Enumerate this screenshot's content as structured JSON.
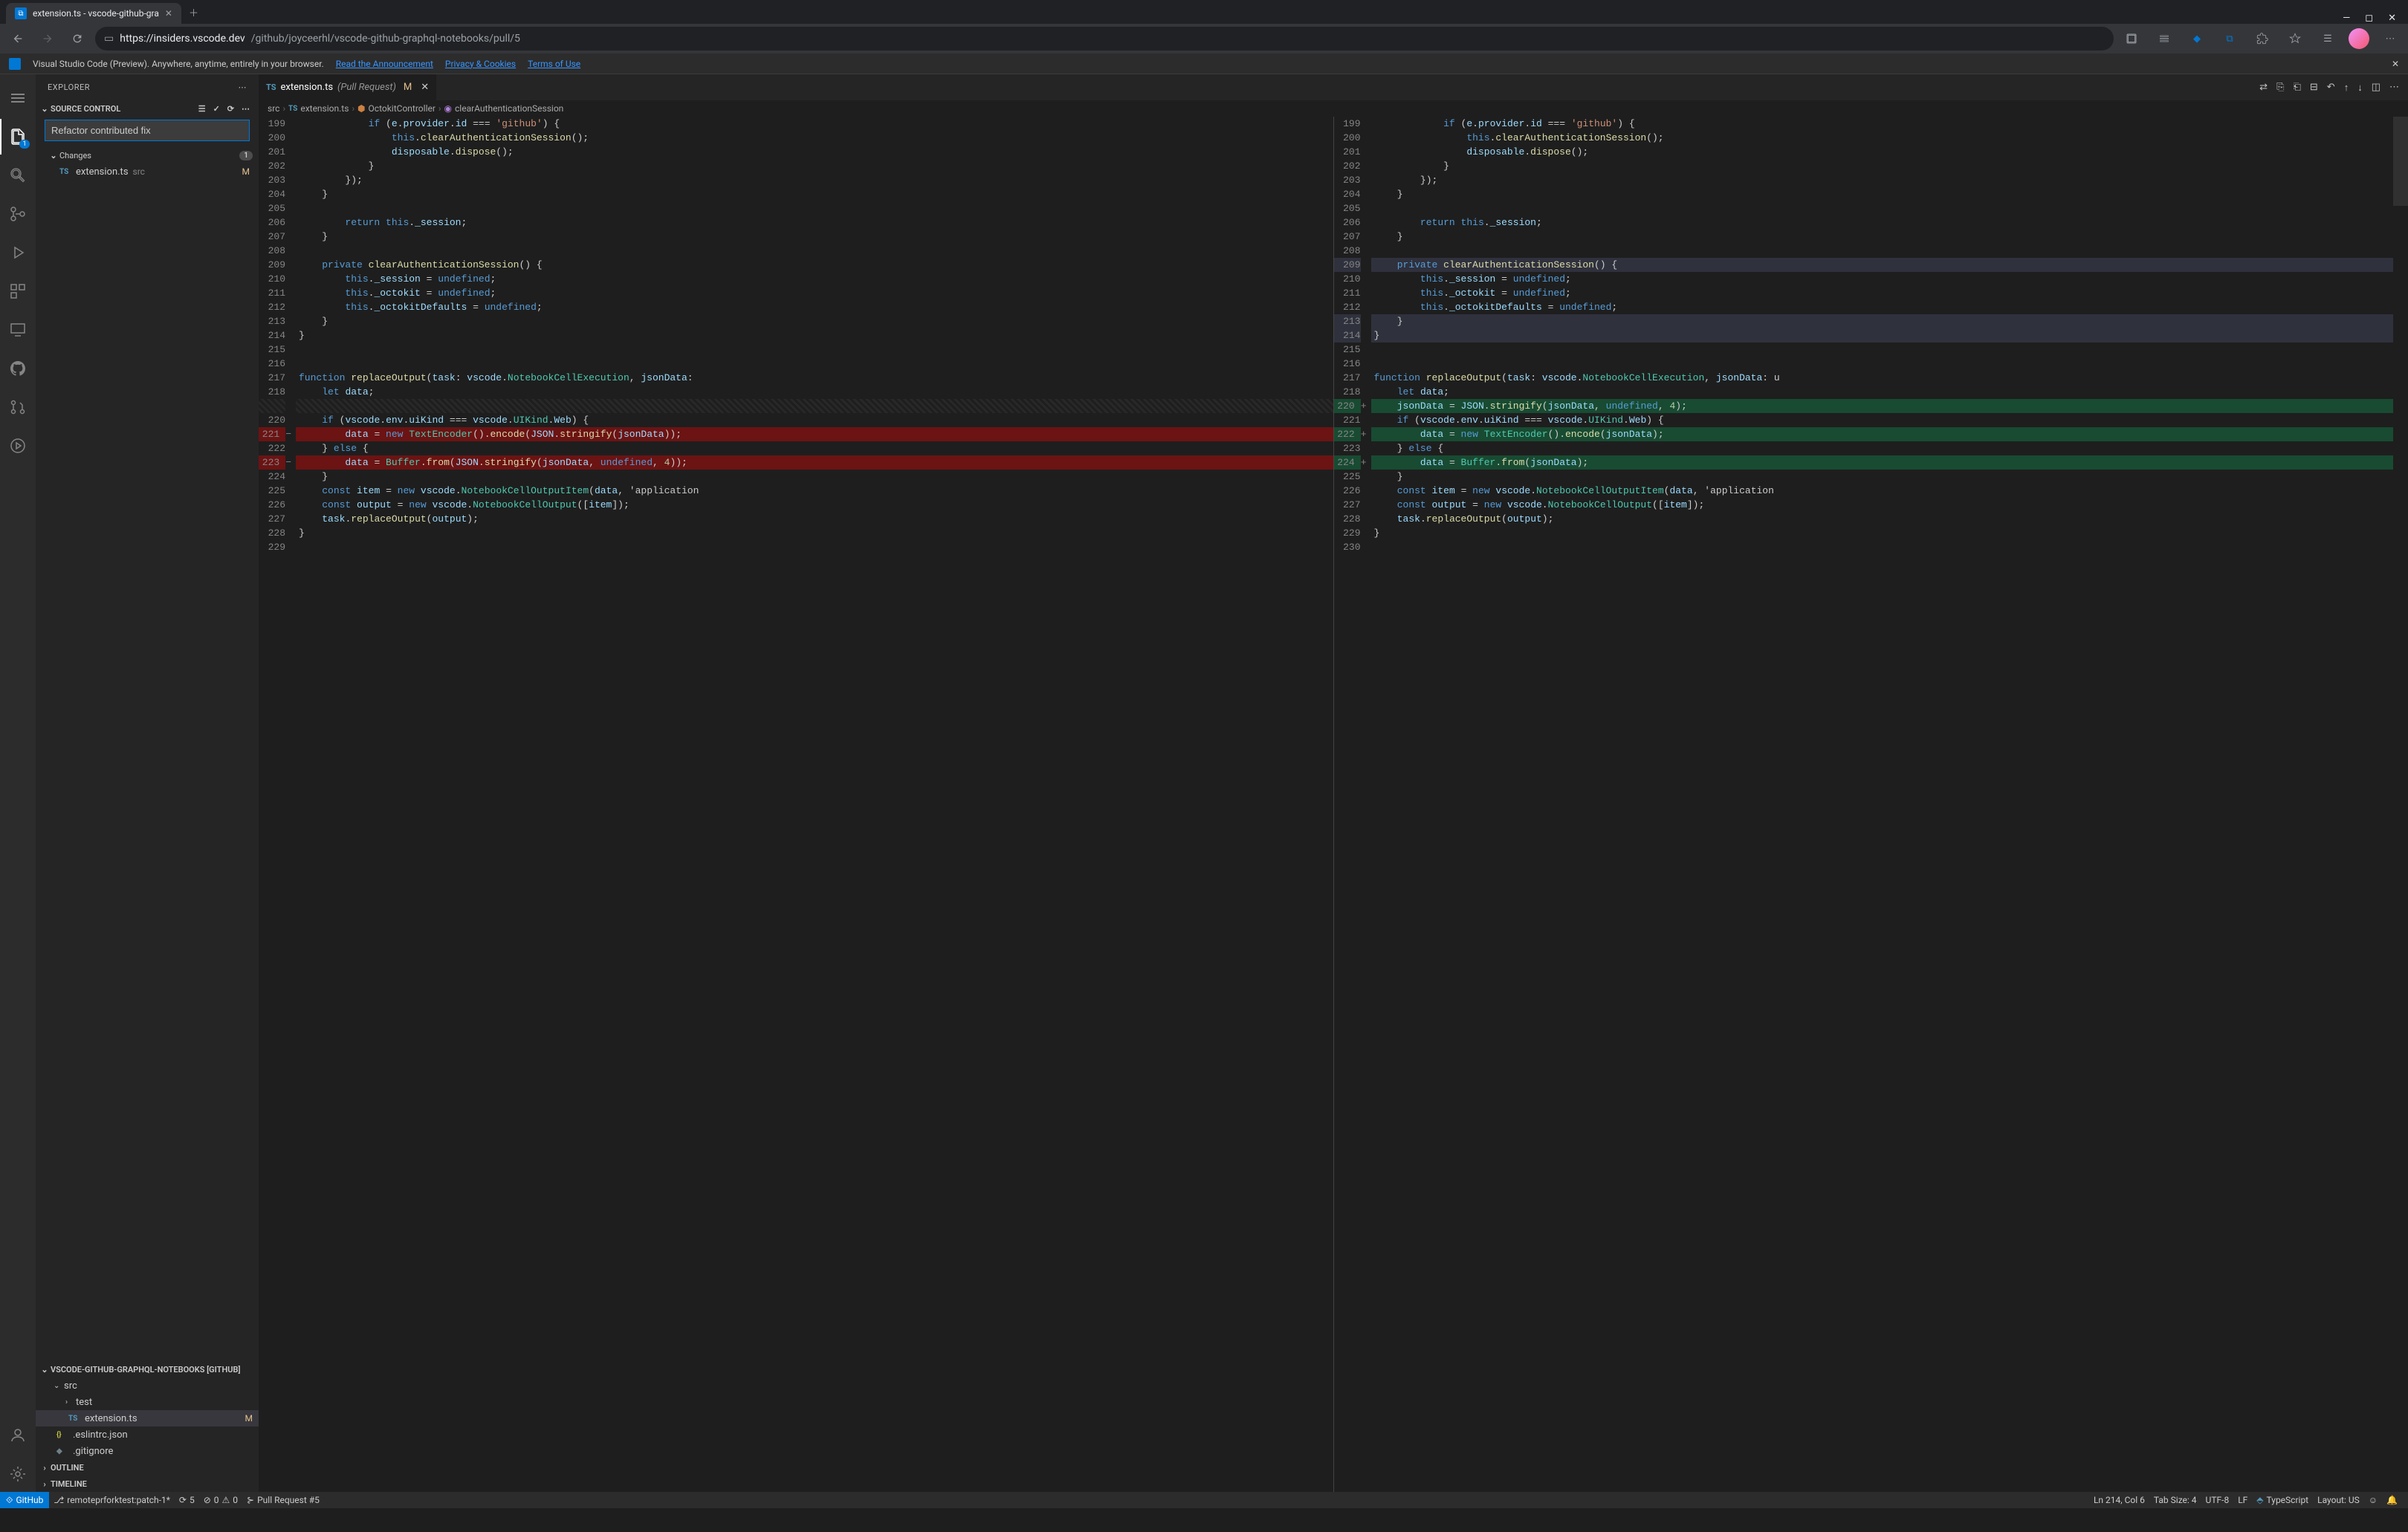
{
  "browser": {
    "tab_title": "extension.ts - vscode-github-gra",
    "url_host": "https://insiders.vscode.dev",
    "url_path": "/github/joyceerhl/vscode-github-graphql-notebooks/pull/5"
  },
  "banner": {
    "text": "Visual Studio Code (Preview). Anywhere, anytime, entirely in your browser.",
    "link1": "Read the Announcement",
    "link2": "Privacy & Cookies",
    "link3": "Terms of Use"
  },
  "sidebar": {
    "title": "EXPLORER",
    "source_control": "SOURCE CONTROL",
    "commit_message": "Refactor contributed fix",
    "changes": "Changes",
    "changes_count": "1",
    "file": "extension.ts",
    "file_path": "src",
    "file_status": "M",
    "repo_section": "VSCODE-GITHUB-GRAPHQL-NOTEBOOKS [GITHUB]",
    "tree": {
      "src": "src",
      "test": "test",
      "extension": "extension.ts",
      "extension_status": "M",
      "eslintrc": ".eslintrc.json",
      "gitignore": ".gitignore"
    },
    "outline": "OUTLINE",
    "timeline": "TIMELINE"
  },
  "activity_badge": "1",
  "tabs": {
    "file_label": "extension.ts",
    "file_suffix": "(Pull Request)",
    "status": "M"
  },
  "breadcrumbs": {
    "p1": "src",
    "p2": "extension.ts",
    "p3": "OctokitController",
    "p4": "clearAuthenticationSession"
  },
  "chart_data": {
    "type": "table",
    "left_start_line": 199,
    "right_start_line": 199,
    "left_lines": [
      {
        "n": 199,
        "t": "            if (e.provider.id === 'github') {"
      },
      {
        "n": 200,
        "t": "                this.clearAuthenticationSession();"
      },
      {
        "n": 201,
        "t": "                disposable.dispose();"
      },
      {
        "n": 202,
        "t": "            }"
      },
      {
        "n": 203,
        "t": "        });"
      },
      {
        "n": 204,
        "t": "    }"
      },
      {
        "n": 205,
        "t": ""
      },
      {
        "n": 206,
        "t": "        return this._session;"
      },
      {
        "n": 207,
        "t": "    }"
      },
      {
        "n": 208,
        "t": ""
      },
      {
        "n": 209,
        "t": "    private clearAuthenticationSession() {"
      },
      {
        "n": 210,
        "t": "        this._session = undefined;"
      },
      {
        "n": 211,
        "t": "        this._octokit = undefined;"
      },
      {
        "n": 212,
        "t": "        this._octokitDefaults = undefined;"
      },
      {
        "n": 213,
        "t": "    }"
      },
      {
        "n": 214,
        "t": "}"
      },
      {
        "n": 215,
        "t": ""
      },
      {
        "n": 216,
        "t": ""
      },
      {
        "n": 217,
        "t": "function replaceOutput(task: vscode.NotebookCellExecution, jsonData: "
      },
      {
        "n": 218,
        "t": "    let data;"
      },
      {
        "n": null,
        "t": "",
        "pad": true
      },
      {
        "n": 220,
        "t": "    if (vscode.env.uiKind === vscode.UIKind.Web) {"
      },
      {
        "n": 221,
        "t": "        data = new TextEncoder().encode(JSON.stringify(jsonData));",
        "removed": true
      },
      {
        "n": 222,
        "t": "    } else {"
      },
      {
        "n": 223,
        "t": "        data = Buffer.from(JSON.stringify(jsonData, undefined, 4));",
        "removed": true
      },
      {
        "n": 224,
        "t": "    }"
      },
      {
        "n": 225,
        "t": "    const item = new vscode.NotebookCellOutputItem(data, 'application"
      },
      {
        "n": 226,
        "t": "    const output = new vscode.NotebookCellOutput([item]);"
      },
      {
        "n": 227,
        "t": "    task.replaceOutput(output);"
      },
      {
        "n": 228,
        "t": "}"
      },
      {
        "n": 229,
        "t": ""
      }
    ],
    "right_lines": [
      {
        "n": 199,
        "t": "            if (e.provider.id === 'github') {"
      },
      {
        "n": 200,
        "t": "                this.clearAuthenticationSession();"
      },
      {
        "n": 201,
        "t": "                disposable.dispose();"
      },
      {
        "n": 202,
        "t": "            }"
      },
      {
        "n": 203,
        "t": "        });"
      },
      {
        "n": 204,
        "t": "    }"
      },
      {
        "n": 205,
        "t": ""
      },
      {
        "n": 206,
        "t": "        return this._session;"
      },
      {
        "n": 207,
        "t": "    }"
      },
      {
        "n": 208,
        "t": ""
      },
      {
        "n": 209,
        "t": "    private clearAuthenticationSession() {",
        "sel": true
      },
      {
        "n": 210,
        "t": "        this._session = undefined;"
      },
      {
        "n": 211,
        "t": "        this._octokit = undefined;"
      },
      {
        "n": 212,
        "t": "        this._octokitDefaults = undefined;"
      },
      {
        "n": 213,
        "t": "    }",
        "sel": true
      },
      {
        "n": 214,
        "t": "}",
        "sel": true,
        "cursor": true
      },
      {
        "n": 215,
        "t": ""
      },
      {
        "n": 216,
        "t": ""
      },
      {
        "n": 217,
        "t": "function replaceOutput(task: vscode.NotebookCellExecution, jsonData: u"
      },
      {
        "n": 218,
        "t": "    let data;"
      },
      {
        "n": 220,
        "t": "    jsonData = JSON.stringify(jsonData, undefined, 4);",
        "added": true
      },
      {
        "n": 221,
        "t": "    if (vscode.env.uiKind === vscode.UIKind.Web) {"
      },
      {
        "n": 222,
        "t": "        data = new TextEncoder().encode(jsonData);",
        "added": true
      },
      {
        "n": 223,
        "t": "    } else {"
      },
      {
        "n": 224,
        "t": "        data = Buffer.from(jsonData);",
        "added": true
      },
      {
        "n": 225,
        "t": "    }"
      },
      {
        "n": 226,
        "t": "    const item = new vscode.NotebookCellOutputItem(data, 'application"
      },
      {
        "n": 227,
        "t": "    const output = new vscode.NotebookCellOutput([item]);"
      },
      {
        "n": 228,
        "t": "    task.replaceOutput(output);"
      },
      {
        "n": 229,
        "t": "}"
      },
      {
        "n": 230,
        "t": ""
      }
    ]
  },
  "status": {
    "remote": "GitHub",
    "branch": "remoteprforktest:patch-1*",
    "sync": "5",
    "errors": "0",
    "warnings": "0",
    "pr": "Pull Request #5",
    "cursor": "Ln 214, Col 6",
    "tab_size": "Tab Size: 4",
    "encoding": "UTF-8",
    "eol": "LF",
    "lang": "TypeScript",
    "layout": "Layout: US"
  }
}
